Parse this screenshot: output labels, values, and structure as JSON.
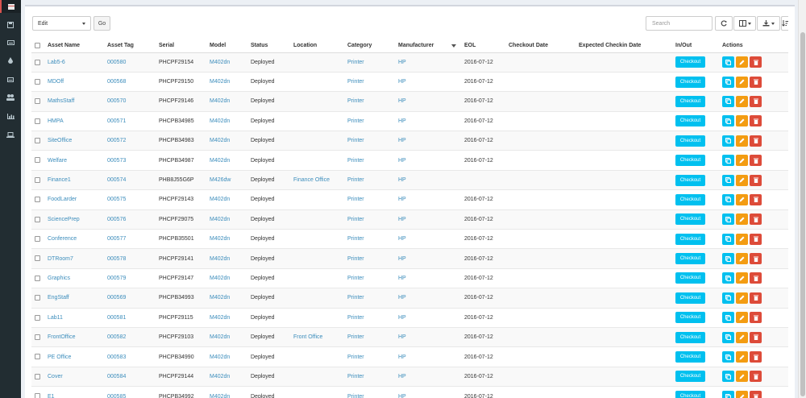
{
  "sidebar": {
    "icons": [
      "barcode-icon",
      "save-icon",
      "keyboard-icon",
      "tint-icon",
      "hdd-icon",
      "users-icon",
      "chart-icon",
      "laptop-icon"
    ]
  },
  "toolbar": {
    "bulk_select_value": "Edit",
    "go_label": "Go",
    "search_placeholder": "Search",
    "refresh_icon": "refresh-icon",
    "columns_icon": "columns-icon",
    "export_icon": "download-icon",
    "sort_icon": "sort-icon"
  },
  "table": {
    "headers": [
      "Asset Name",
      "Asset Tag",
      "Serial",
      "Model",
      "Status",
      "Location",
      "Category",
      "Manufacturer",
      "EOL",
      "Checkout Date",
      "Expected Checkin Date",
      "In/Out",
      "Actions"
    ],
    "checkout_label": "Checkout",
    "rows": [
      {
        "name": "Lab5-6",
        "tag": "000580",
        "serial": "PHCPF29154",
        "model": "M402dn",
        "status": "Deployed",
        "location": "",
        "category": "Printer",
        "manufacturer": "HP",
        "eol": "2016-07-12"
      },
      {
        "name": "MDOff",
        "tag": "000568",
        "serial": "PHCPF29150",
        "model": "M402dn",
        "status": "Deployed",
        "location": "",
        "category": "Printer",
        "manufacturer": "HP",
        "eol": "2016-07-12"
      },
      {
        "name": "MathsStaff",
        "tag": "000570",
        "serial": "PHCPF29146",
        "model": "M402dn",
        "status": "Deployed",
        "location": "",
        "category": "Printer",
        "manufacturer": "HP",
        "eol": "2016-07-12"
      },
      {
        "name": "HMPA",
        "tag": "000571",
        "serial": "PHCPB34985",
        "model": "M402dn",
        "status": "Deployed",
        "location": "",
        "category": "Printer",
        "manufacturer": "HP",
        "eol": "2016-07-12"
      },
      {
        "name": "SiteOffice",
        "tag": "000572",
        "serial": "PHCPB34983",
        "model": "M402dn",
        "status": "Deployed",
        "location": "",
        "category": "Printer",
        "manufacturer": "HP",
        "eol": "2016-07-12"
      },
      {
        "name": "Welfare",
        "tag": "000573",
        "serial": "PHCPB34987",
        "model": "M402dn",
        "status": "Deployed",
        "location": "",
        "category": "Printer",
        "manufacturer": "HP",
        "eol": "2016-07-12"
      },
      {
        "name": "Finance1",
        "tag": "000574",
        "serial": "PHB8J55G6P",
        "model": "M426dw",
        "status": "Deployed",
        "location": "Finance Office",
        "category": "Printer",
        "manufacturer": "HP",
        "eol": ""
      },
      {
        "name": "FoodLarder",
        "tag": "000575",
        "serial": "PHCPF29143",
        "model": "M402dn",
        "status": "Deployed",
        "location": "",
        "category": "Printer",
        "manufacturer": "HP",
        "eol": "2016-07-12"
      },
      {
        "name": "SciencePrep",
        "tag": "000576",
        "serial": "PHCPF29075",
        "model": "M402dn",
        "status": "Deployed",
        "location": "",
        "category": "Printer",
        "manufacturer": "HP",
        "eol": "2016-07-12"
      },
      {
        "name": "Conference",
        "tag": "000577",
        "serial": "PHCPB35501",
        "model": "M402dn",
        "status": "Deployed",
        "location": "",
        "category": "Printer",
        "manufacturer": "HP",
        "eol": "2016-07-12"
      },
      {
        "name": "DTRoom7",
        "tag": "000578",
        "serial": "PHCPF29141",
        "model": "M402dn",
        "status": "Deployed",
        "location": "",
        "category": "Printer",
        "manufacturer": "HP",
        "eol": "2016-07-12"
      },
      {
        "name": "Graphics",
        "tag": "000579",
        "serial": "PHCPF29147",
        "model": "M402dn",
        "status": "Deployed",
        "location": "",
        "category": "Printer",
        "manufacturer": "HP",
        "eol": "2016-07-12"
      },
      {
        "name": "EngStaff",
        "tag": "000569",
        "serial": "PHCPB34993",
        "model": "M402dn",
        "status": "Deployed",
        "location": "",
        "category": "Printer",
        "manufacturer": "HP",
        "eol": "2016-07-12"
      },
      {
        "name": "Lab11",
        "tag": "000581",
        "serial": "PHCPF29115",
        "model": "M402dn",
        "status": "Deployed",
        "location": "",
        "category": "Printer",
        "manufacturer": "HP",
        "eol": "2016-07-12"
      },
      {
        "name": "FrontOffice",
        "tag": "000582",
        "serial": "PHCPF29103",
        "model": "M402dn",
        "status": "Deployed",
        "location": "Front Office",
        "category": "Printer",
        "manufacturer": "HP",
        "eol": "2016-07-12"
      },
      {
        "name": "PE Office",
        "tag": "000583",
        "serial": "PHCPB34990",
        "model": "M402dn",
        "status": "Deployed",
        "location": "",
        "category": "Printer",
        "manufacturer": "HP",
        "eol": "2016-07-12"
      },
      {
        "name": "Cover",
        "tag": "000584",
        "serial": "PHCPF29144",
        "model": "M402dn",
        "status": "Deployed",
        "location": "",
        "category": "Printer",
        "manufacturer": "HP",
        "eol": "2016-07-12"
      },
      {
        "name": "E1",
        "tag": "000585",
        "serial": "PHCPB34992",
        "model": "M402dn",
        "status": "Deployed",
        "location": "",
        "category": "Printer",
        "manufacturer": "HP",
        "eol": "2016-07-12"
      }
    ]
  },
  "colors": {
    "sidebar_bg": "#222d32",
    "link": "#3c8dbc",
    "checkout": "#00c0ef",
    "edit": "#f39c12",
    "delete": "#dd4b39"
  }
}
